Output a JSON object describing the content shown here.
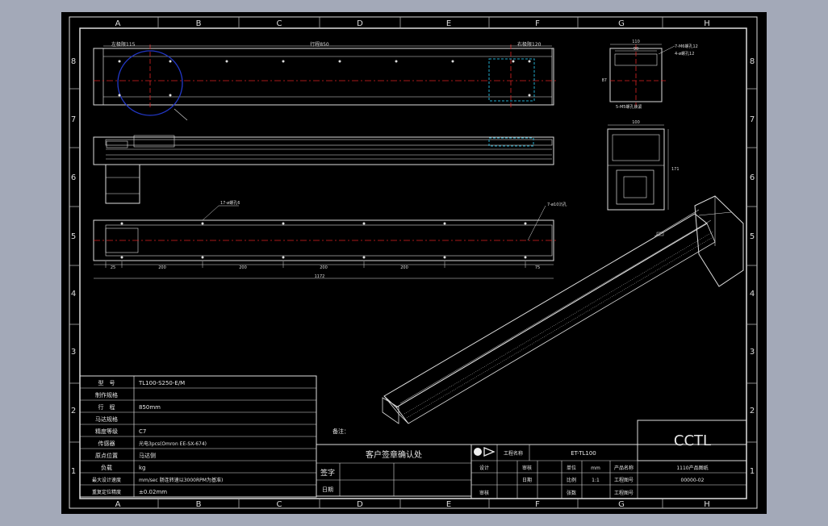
{
  "drawing": {
    "zone_letters": [
      "A",
      "B",
      "C",
      "D",
      "E",
      "F",
      "G",
      "H"
    ],
    "zone_numbers": [
      "8",
      "7",
      "6",
      "5",
      "4",
      "3",
      "2",
      "1"
    ],
    "top_view": {
      "dim_left": "左极限115",
      "dim_stroke": "行程850",
      "dim_right": "右极限120"
    },
    "bottom_view": {
      "note_left": "17-ø螺孔6",
      "note_right": "7-ø10沉孔",
      "dims": [
        "25",
        "200",
        "200",
        "200",
        "200",
        "75",
        "1172"
      ]
    },
    "side_view": {
      "dim_top": "110",
      "dim_inner": "90",
      "dim_height": "87",
      "note_1": "7-M6螺孔12",
      "note_2": "4-ø螺孔12",
      "note_3": "5-M5螺孔锁紧"
    },
    "end_view": {
      "dim_top": "100",
      "dim_height": "171"
    },
    "spec_table": [
      {
        "label": "型　号",
        "value": "TL100-S250-E/M"
      },
      {
        "label": "制作规格",
        "value": ""
      },
      {
        "label": "行　程",
        "value": "850mm"
      },
      {
        "label": "马达规格",
        "value": ""
      },
      {
        "label": "精度等级",
        "value": "C7"
      },
      {
        "label": "传感器",
        "value": "光电3pcs(Omron EE-SX-674)"
      },
      {
        "label": "原点位置",
        "value": "马达侧"
      },
      {
        "label": "负载",
        "value": "kg"
      },
      {
        "label": "最大设计速度",
        "value": "mm/sec 肠连转速以3000RPM为基准)"
      },
      {
        "label": "重复定位精度",
        "value": "±0.02mm"
      }
    ],
    "note_label": "备注：",
    "customer_box": {
      "title": "客户签章确认处",
      "sign_label": "签字",
      "date_label": "日期"
    },
    "title_block": {
      "model_label": "工程名称",
      "model_value": "ET-TL100",
      "company": "CCTL",
      "rows": [
        {
          "c1": "设计",
          "c2": "",
          "c3": "审核",
          "c4": "",
          "c5": "单位",
          "c6": "mm",
          "c7": "产品名称",
          "c8": "1110产品图纸"
        },
        {
          "c1": "",
          "c2": "",
          "c3": "日期",
          "c4": "",
          "c5": "比例",
          "c6": "1:1",
          "c7": "工程图号",
          "c8": "00000-02"
        },
        {
          "c1": "审核",
          "c2": "",
          "c3": "",
          "c4": "",
          "c5": "张数",
          "c6": "",
          "c7": "工程图号",
          "c8": ""
        }
      ]
    }
  }
}
